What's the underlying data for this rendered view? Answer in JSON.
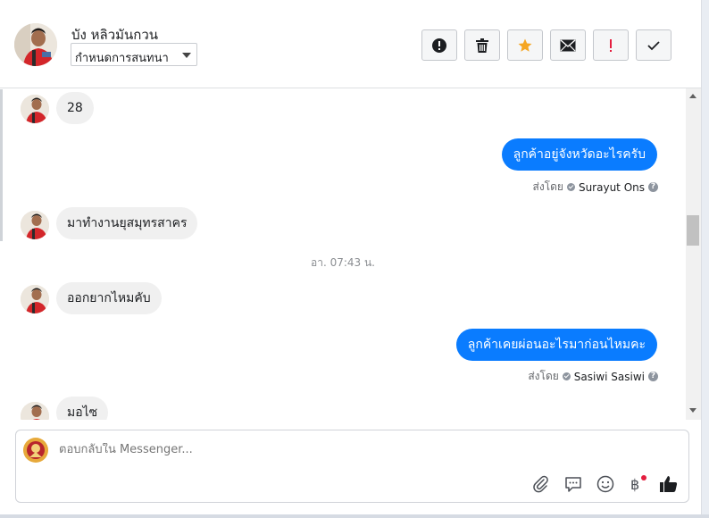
{
  "header": {
    "contact_name": "บัง หลิวมันกวน",
    "assign_label": "กำหนดการสนทนา",
    "actions": [
      {
        "icon": "alert-circle-icon",
        "name": "mark-spam-button"
      },
      {
        "icon": "trash-icon",
        "name": "delete-button"
      },
      {
        "icon": "star-icon",
        "name": "star-button"
      },
      {
        "icon": "envelope-icon",
        "name": "mark-unread-button"
      },
      {
        "icon": "exclamation-icon",
        "name": "follow-up-button"
      },
      {
        "icon": "checkmark-icon",
        "name": "done-button"
      }
    ]
  },
  "thread": {
    "messages": [
      {
        "direction": "in",
        "text": "28"
      },
      {
        "direction": "out",
        "text": "ลูกค้าอยู่จังหวัดอะไรครับ",
        "sent_by_label": "ส่งโดย",
        "sender": "Surayut Ons"
      },
      {
        "direction": "in",
        "text": "มาทำงานยุสมุทรสาคร"
      },
      {
        "direction": "in",
        "text": "ออกยากไหมคับ"
      },
      {
        "direction": "out",
        "text": "ลูกค้าเคยผ่อนอะไรมาก่อนไหมคะ",
        "sent_by_label": "ส่งโดย",
        "sender": "Sasiwi Sasiwi"
      },
      {
        "direction": "in",
        "text": "มอไซ"
      }
    ],
    "timestamp": "อา. 07:43 น."
  },
  "composer": {
    "placeholder": "ตอบกลับใน Messenger...",
    "tools": [
      "attach-icon",
      "saved-reply-icon",
      "emoji-icon",
      "baht-payment-icon",
      "thumbs-up-icon"
    ]
  },
  "colors": {
    "outgoing_bubble": "#0a7cff",
    "incoming_bubble": "#f0f0f0",
    "star": "#f5a623",
    "alert": "#e41e3f"
  }
}
